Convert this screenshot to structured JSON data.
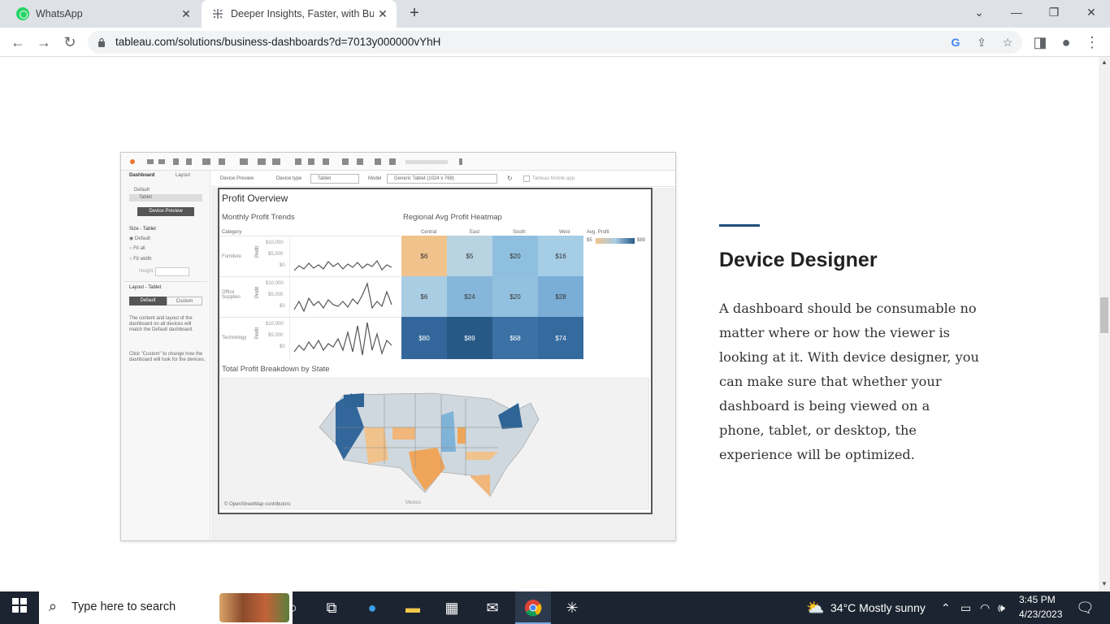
{
  "browser": {
    "tabs": [
      {
        "title": "WhatsApp",
        "active": false,
        "icon": "whatsapp-icon"
      },
      {
        "title": "Deeper Insights, Faster, with Busi",
        "active": true,
        "icon": "tableau-icon"
      }
    ],
    "new_tab": "+",
    "url": "tableau.com/solutions/business-dashboards?d=7013y000000vYhH"
  },
  "dashboard": {
    "left_panel": {
      "tab_dashboard": "Dashboard",
      "tab_layout": "Layout",
      "default_label": "Default",
      "tablet_label": "Tablet",
      "device_preview_btn": "Device Preview",
      "size_title": "Size - Tablet",
      "size_options": [
        "Default",
        "Fit all",
        "Fit width"
      ],
      "height_label": "Height",
      "layout_title": "Layout - Tablet",
      "layout_default": "Default",
      "layout_custom": "Custom",
      "desc1": "The content and layout of the dashboard on all devices will match the Default dashboard.",
      "desc2": "Click \"Custom\" to change how the dashboard will look for the devices."
    },
    "device_bar": {
      "preview": "Device Preview",
      "device_type_label": "Device type",
      "device_type_value": "Tablet",
      "model_label": "Model",
      "model_value": "Generic Tablet (1024 x 768)",
      "mobile_app": "Tableau Mobile app"
    },
    "title": "Profit Overview",
    "trends_title": "Monthly Profit Trends",
    "category_label": "Category",
    "profit_axis": "Profit",
    "axis_ticks": [
      "$10,000",
      "$5,000",
      "$0"
    ],
    "categories": [
      "Furniture",
      "Office Supplies",
      "Technology"
    ],
    "heatmap_title": "Regional Avg Profit Heatmap",
    "regions": [
      "Central",
      "East",
      "South",
      "West"
    ],
    "legend_title": "Avg. Profit",
    "legend_min": "$5",
    "legend_max": "$89",
    "heatmap_values": [
      [
        "$6",
        "$5",
        "$20",
        "$16"
      ],
      [
        "$6",
        "$24",
        "$20",
        "$28"
      ],
      [
        "$80",
        "$89",
        "$68",
        "$74"
      ]
    ],
    "map_title": "Total Profit Breakdown by State",
    "map_credit": "© OpenStreetMap contributors",
    "map_label_mexico": "Mexico"
  },
  "section": {
    "title": "Device Designer",
    "body": "A dashboard should be consumable no matter where or how the viewer is looking at it. With device designer, you can make sure that whether your dashboard is being viewed on a phone, tablet, or desktop, the experience will be optimized."
  },
  "taskbar": {
    "search_placeholder": "Type here to search",
    "weather": "34°C  Mostly sunny",
    "time": "3:45 PM",
    "date": "4/23/2023"
  },
  "colors": {
    "accent": "#1f4e79",
    "orange": "#f0b67a",
    "light_blue": "#a9cde3",
    "mid_blue": "#7fb3d8",
    "dark_blue": "#2e6496"
  }
}
